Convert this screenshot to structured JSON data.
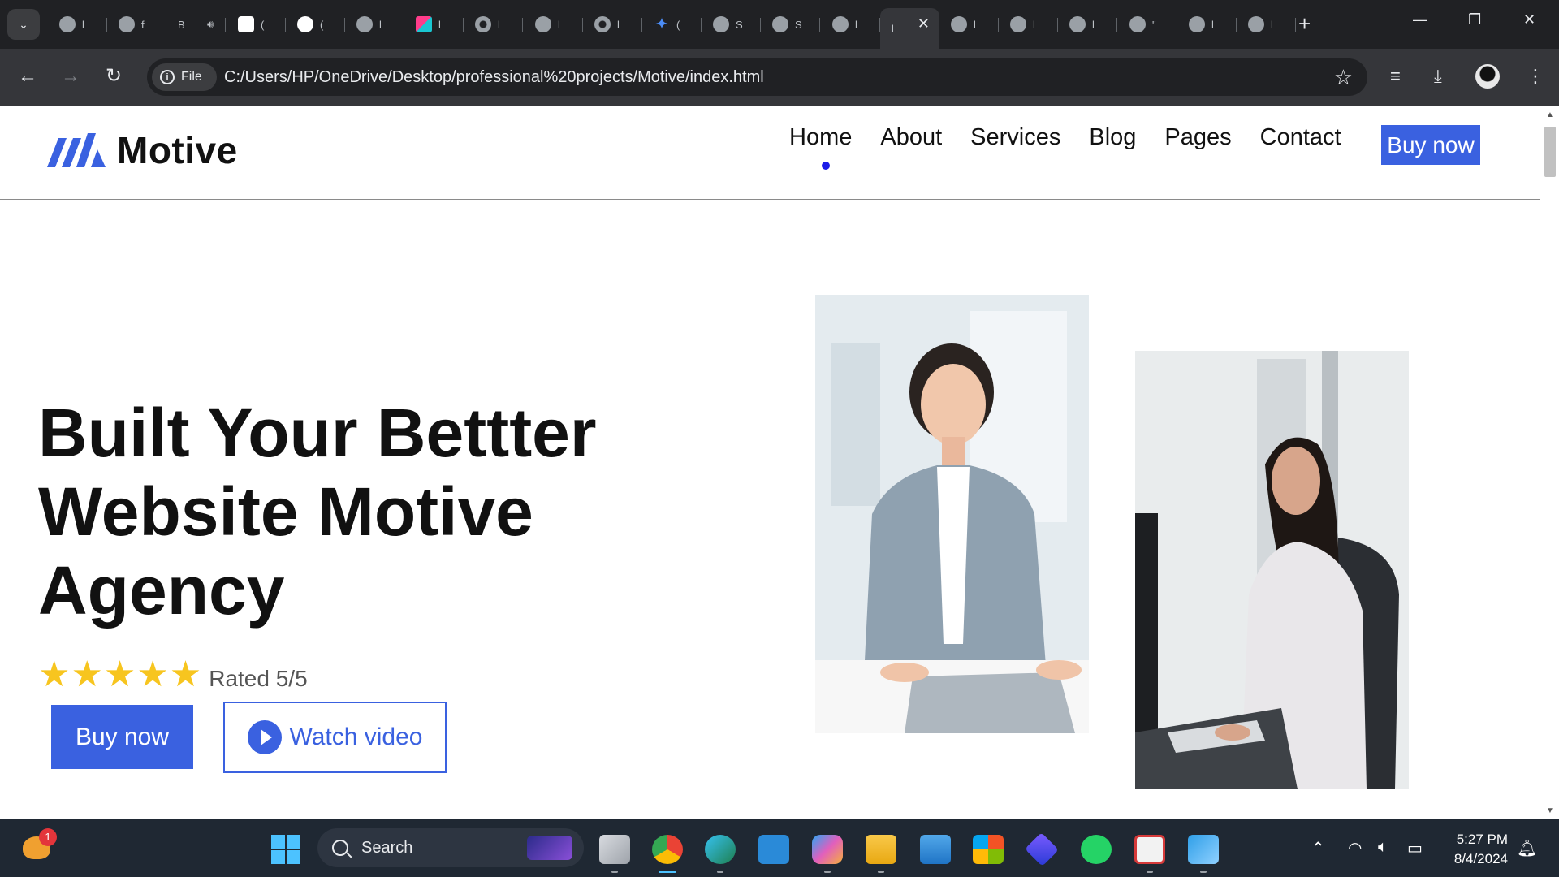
{
  "browser": {
    "tabs": [
      {
        "kind": "globe",
        "text": "l"
      },
      {
        "kind": "globe",
        "text": "f"
      },
      {
        "kind": "speaker",
        "text": "B"
      },
      {
        "kind": "gpt",
        "text": "("
      },
      {
        "kind": "gh",
        "text": "("
      },
      {
        "kind": "globe",
        "text": "l"
      },
      {
        "kind": "cube",
        "text": "l"
      },
      {
        "kind": "chr",
        "text": "l"
      },
      {
        "kind": "globe",
        "text": "l"
      },
      {
        "kind": "chr",
        "text": "l"
      },
      {
        "kind": "gem",
        "text": "("
      },
      {
        "kind": "globe",
        "text": "S"
      },
      {
        "kind": "globe",
        "text": "S"
      },
      {
        "kind": "globe",
        "text": "l"
      },
      {
        "kind": "active",
        "text": "l"
      },
      {
        "kind": "globe",
        "text": "l"
      },
      {
        "kind": "globe",
        "text": "l"
      },
      {
        "kind": "globe",
        "text": "l"
      },
      {
        "kind": "globe",
        "text": "\""
      },
      {
        "kind": "globe",
        "text": "l"
      },
      {
        "kind": "globe",
        "text": "l"
      }
    ],
    "site_chip": "File",
    "url": "C:/Users/HP/OneDrive/Desktop/professional%20projects/Motive/index.html",
    "icons": {
      "tab_search": "chevron-down-icon",
      "back": "arrow-left-icon",
      "forward": "arrow-right-icon",
      "reload": "reload-icon",
      "bookmark": "star-icon",
      "media": "media-queue-icon",
      "downloads": "download-icon",
      "menu": "kebab-menu-icon"
    }
  },
  "site": {
    "brand": "Motive",
    "brand_color": "#3a61e0",
    "nav": [
      "Home",
      "About",
      "Services",
      "Blog",
      "Pages",
      "Contact"
    ],
    "active_nav": "Home",
    "header_cta": "Buy now",
    "hero": {
      "title": "Built Your Bettter Website Motive Agency",
      "stars": "★★★★★",
      "rating_value": 5,
      "rating_max": 5,
      "rating_text": "Rated 5/5",
      "primary_cta": "Buy now",
      "secondary_cta": "Watch video"
    }
  },
  "taskbar": {
    "weather_badge": "1",
    "search_placeholder": "Search",
    "apps": [
      "task-view",
      "chrome",
      "edge",
      "vscode",
      "copilot",
      "file-explorer",
      "mail",
      "microsoft-store",
      "clipchamp",
      "whatsapp",
      "snipping-tool",
      "photos"
    ],
    "time": "5:27 PM",
    "date": "8/4/2024"
  }
}
